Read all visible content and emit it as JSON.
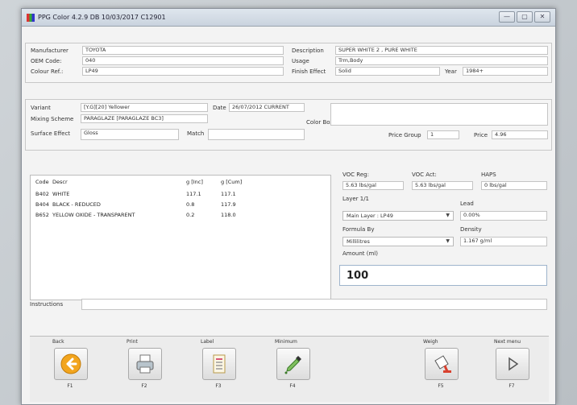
{
  "window": {
    "title": "PPG Color 4.2.9 DB 10/03/2017 C12901",
    "btn_min": "—",
    "btn_max": "▢",
    "btn_close": "✕"
  },
  "header": {
    "manufacturer_label": "Manufacturer",
    "manufacturer_value": "TOYOTA",
    "oem_code_label": "OEM Code:",
    "oem_code_value": "040",
    "colour_ref_label": "Colour Ref.:",
    "colour_ref_value": "LP49",
    "description_label": "Description",
    "description_value": "SUPER WHITE 2 , PURE WHITE",
    "usage_label": "Usage",
    "usage_value": "Trm,Body",
    "finish_effect_label": "Finish Effect",
    "finish_effect_value": "Solid",
    "year_label": "Year",
    "year_value": "1984+"
  },
  "variant": {
    "variant_label": "Variant",
    "variant_value": "[Y.G][20] Yellower",
    "date_label": "Date",
    "date_value": "26/07/2012 CURRENT",
    "mixing_scheme_label": "Mixing Scheme",
    "mixing_scheme_value": "PARAGLAZE [PARAGLAZE BC3]",
    "surface_effect_label": "Surface Effect",
    "surface_effect_value": "Gloss",
    "match_label": "Match",
    "match_value": "",
    "color_box_label": "Color Box",
    "price_group_label": "Price Group",
    "price_group_value": "1",
    "price_label": "Price",
    "price_value": "4.96"
  },
  "formula_table": {
    "headers": [
      "Code",
      "Descr",
      "g [Inc]",
      "g [Cum]"
    ],
    "rows": [
      [
        "B402",
        "WHITE",
        "117.1",
        "117.1"
      ],
      [
        "B404",
        "BLACK - REDUCED",
        "0.8",
        "117.9"
      ],
      [
        "B652",
        "YELLOW OXIDE - TRANSPARENT",
        "0.2",
        "118.0"
      ]
    ]
  },
  "right_panel": {
    "voc_reg_label": "VOC Reg:",
    "voc_reg_value": "5.63 lbs/gal",
    "voc_act_label": "VOC Act:",
    "voc_act_value": "5.63 lbs/gal",
    "haps_label": "HAPS",
    "haps_value": "0 lbs/gal",
    "layer_label": "Layer 1/1",
    "layer_value": "Main Layer : LP49",
    "lead_label": "Lead",
    "lead_value": "0.00%",
    "formula_by_label": "Formula By",
    "formula_by_value": "Millilitres",
    "density_label": "Density",
    "density_value": "1.167 g/ml",
    "amount_label": "Amount (ml)",
    "amount_value": "100"
  },
  "instructions": {
    "label": "Instructions",
    "value": ""
  },
  "toolbar": {
    "buttons": [
      {
        "top": "Back",
        "key": "F1"
      },
      {
        "top": "Print",
        "key": "F2"
      },
      {
        "top": "Label",
        "key": "F3"
      },
      {
        "top": "Minimum",
        "key": "F4"
      },
      {
        "top": "Weigh",
        "key": "F5"
      },
      {
        "top": "Next menu",
        "key": "F7"
      }
    ]
  },
  "colors": {
    "accent": "#f0a020",
    "window_bg": "#f3f3f3",
    "panel_border": "#c8c8c8"
  },
  "icons": [
    "back-arrow-icon",
    "printer-icon",
    "label-icon",
    "dropper-icon",
    "weigh-can-icon",
    "play-icon"
  ]
}
